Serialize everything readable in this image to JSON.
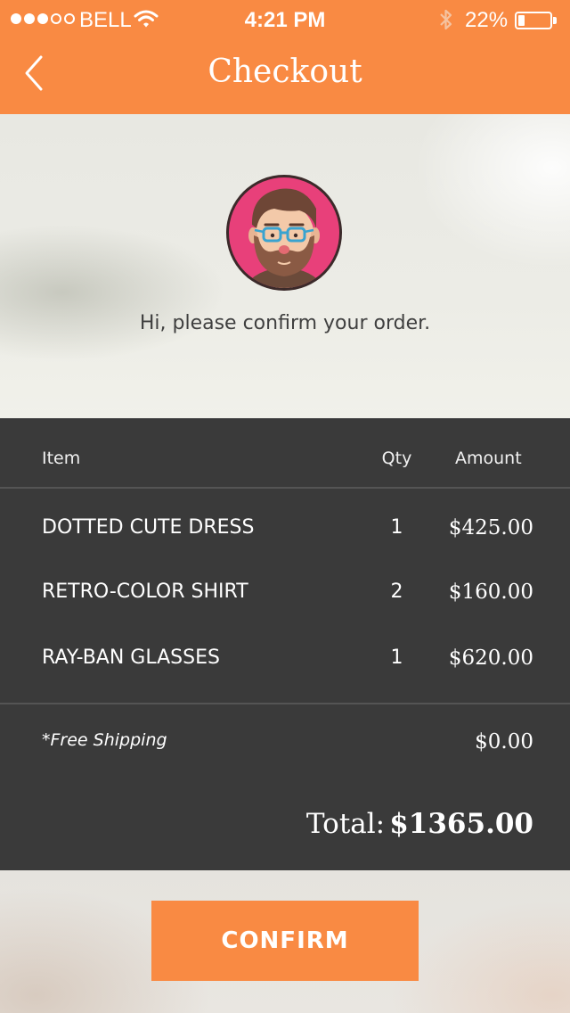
{
  "status_bar": {
    "carrier": "BELL",
    "time": "4:21 PM",
    "battery_text": "22%",
    "battery_level": 0.22,
    "signal_bars_filled": 3,
    "signal_bars_total": 5,
    "icons": [
      "wifi-icon",
      "bluetooth-icon",
      "battery-icon"
    ]
  },
  "nav": {
    "title": "Checkout",
    "back_icon": "chevron-left-icon"
  },
  "hero": {
    "avatar_icon": "bearded-man-avatar",
    "greeting": "Hi, please confirm your order."
  },
  "order": {
    "headers": {
      "item": "Item",
      "qty": "Qty",
      "amount": "Amount"
    },
    "items": [
      {
        "name": "DOTTED CUTE DRESS",
        "qty": "1",
        "amount": "$425.00"
      },
      {
        "name": "RETRO-COLOR SHIRT",
        "qty": "2",
        "amount": "$160.00"
      },
      {
        "name": "RAY-BAN GLASSES",
        "qty": "1",
        "amount": "$620.00"
      }
    ],
    "shipping_label": "*Free Shipping",
    "shipping_amount": "$0.00",
    "total_label": "Total:",
    "total_value": "$1365.00"
  },
  "actions": {
    "confirm_label": "CONFIRM"
  },
  "colors": {
    "accent": "#f98a43",
    "panel": "#3a3a3a",
    "avatar_bg": "#e8407a"
  }
}
